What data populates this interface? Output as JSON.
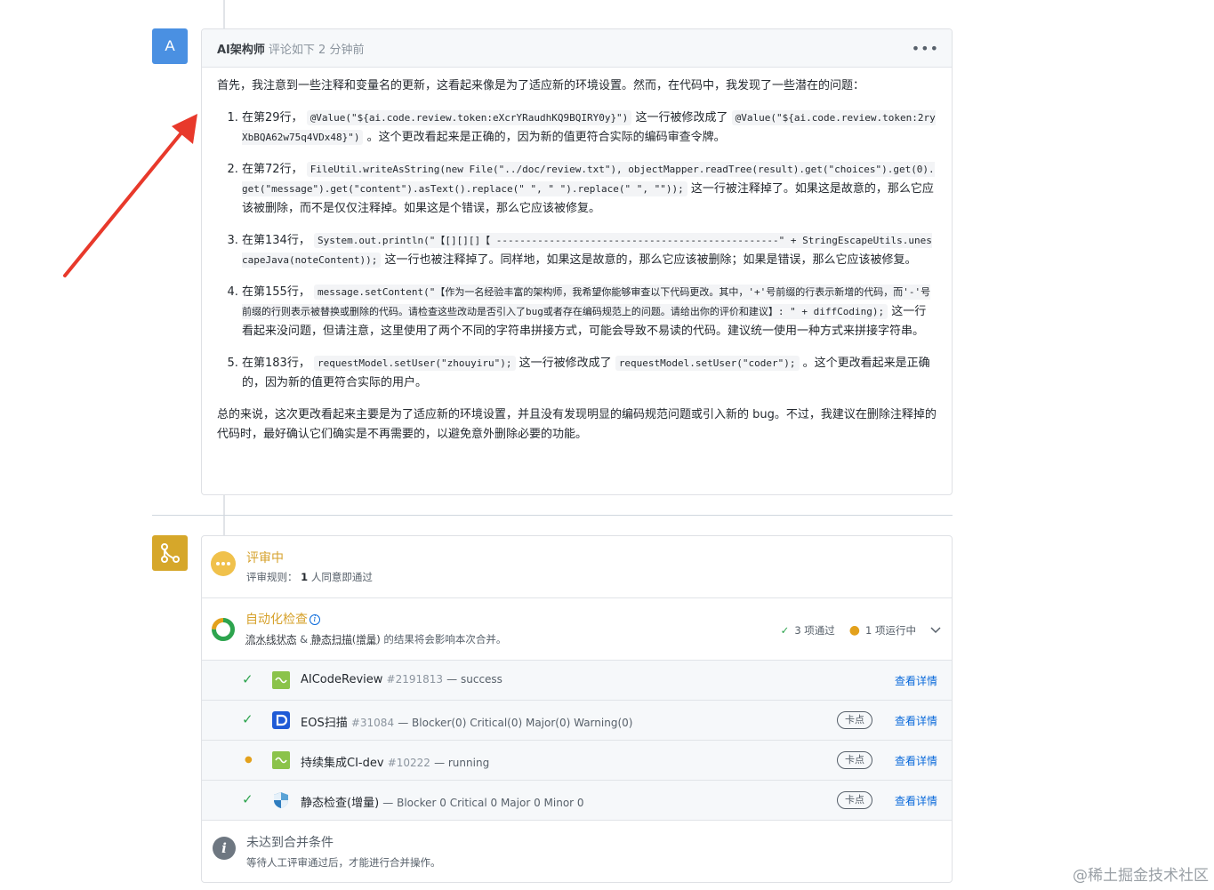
{
  "comment": {
    "avatar_letter": "A",
    "author": "AI架构师",
    "meta": "评论如下 2 分钟前",
    "more_label": "•••",
    "intro": "首先，我注意到一些注释和变量名的更新，这看起来像是为了适应新的环境设置。然而，在代码中，我发现了一些潜在的问题：",
    "items": [
      {
        "t1": "在第29行，",
        "c1": "@Value(\"${ai.code.review.token:eXcrYRaudhKQ9BQIRY0y}\")",
        "t2": "这一行被修改成了",
        "c2": "@Value(\"${ai.code.review.token:2ryXbBQA62w75q4VDx48}\")",
        "t3": "。这个更改看起来是正确的，因为新的值更符合实际的编码审查令牌。"
      },
      {
        "t1": "在第72行，",
        "c1": "FileUtil.writeAsString(new File(\"../doc/review.txt\"), objectMapper.readTree(result).get(\"choices\").get(0).get(\"message\").get(\"content\").asText().replace(\" \", \" \").replace(\" \", \"\"));",
        "t2": "这一行被注释掉了。如果这是故意的，那么它应该被删除，而不是仅仅注释掉。如果这是个错误，那么它应该被修复。"
      },
      {
        "t1": "在第134行，",
        "c1": "System.out.println(\"【[][][]【 ------------------------------------------------\" + StringEscapeUtils.unescapeJava(noteContent));",
        "t2": "这一行也被注释掉了。同样地，如果这是故意的，那么它应该被删除；如果是错误，那么它应该被修复。"
      },
      {
        "t1": "在第155行，",
        "c1": "message.setContent(\"【作为一名经验丰富的架构师，我希望你能够审查以下代码更改。其中，'+'号前缀的行表示新增的代码，而'-'号前缀的行则表示被替换或删除的代码。请检查这些改动是否引入了bug或者存在编码规范上的问题。请给出你的评价和建议】: \" + diffCoding);",
        "t2": "这一行看起来没问题，但请注意，这里使用了两个不同的字符串拼接方式，可能会导致不易读的代码。建议统一使用一种方式来拼接字符串。"
      },
      {
        "t1": "在第183行，",
        "c1": "requestModel.setUser(\"zhouyiru\");",
        "t2": "这一行被修改成了",
        "c2": "requestModel.setUser(\"coder\");",
        "t3": "。这个更改看起来是正确的，因为新的值更符合实际的用户。"
      }
    ],
    "summary": "总的来说，这次更改看起来主要是为了适应新的环境设置，并且没有发现明显的编码规范问题或引入新的 bug。不过，我建议在删除注释掉的代码时，最好确认它们确实是不再需要的，以避免意外删除必要的功能。"
  },
  "merge": {
    "review": {
      "title": "评审中",
      "rule_label": "评审规则：",
      "rule_count": "1",
      "rule_text": "人同意即通过"
    },
    "auto": {
      "title": "自动化检查",
      "info": "i",
      "desc_link1": "流水线状态",
      "desc_amp": " & ",
      "desc_link2": "静态扫描(增量)",
      "desc_rest": " 的结果将会影响本次合并。",
      "passed_mark": "✓",
      "passed": "3 项通过",
      "running_mark": "●",
      "running": "1 项运行中"
    },
    "checks": [
      {
        "status": "✓",
        "name": "AICodeReview",
        "num": "#2191813",
        "desc": " — success",
        "kadian": "",
        "detail": "查看详情"
      },
      {
        "status": "✓",
        "name": "EOS扫描",
        "num": "#31084",
        "desc": " — Blocker(0) Critical(0) Major(0) Warning(0)",
        "kadian": "卡点",
        "detail": "查看详情"
      },
      {
        "status": "●",
        "name": "持续集成CI-dev",
        "num": "#10222",
        "desc": " — running",
        "kadian": "卡点",
        "detail": "查看详情"
      },
      {
        "status": "✓",
        "name": "静态检查(增量)",
        "num": "",
        "desc": " — Blocker 0 Critical 0 Major 0 Minor 0",
        "kadian": "卡点",
        "detail": "查看详情"
      }
    ],
    "bottom": {
      "icon": "i",
      "title": "未达到合并条件",
      "desc": "等待人工评审通过后，才能进行合并操作。"
    }
  },
  "watermark": "@稀土掘金技术社区",
  "colors": {
    "accent": "#d6a12b",
    "link": "#0969da",
    "success": "#2da44e",
    "avatar": "#4a90e2",
    "arrow": "#e8392b"
  }
}
